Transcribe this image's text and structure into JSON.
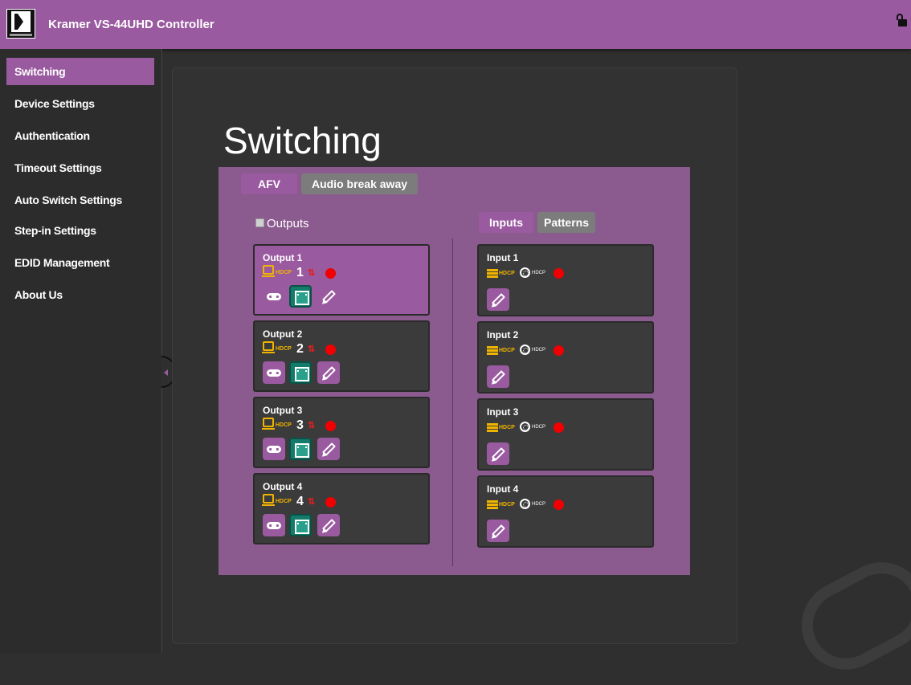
{
  "header": {
    "title": "Kramer VS-44UHD Controller"
  },
  "sidebar": {
    "items": [
      {
        "label": "Switching"
      },
      {
        "label": "Device Settings"
      },
      {
        "label": "Authentication"
      },
      {
        "label": "Timeout Settings"
      },
      {
        "label": "Auto Switch Settings"
      },
      {
        "label": "Step-in Settings"
      },
      {
        "label": "EDID Management"
      },
      {
        "label": "About Us"
      }
    ]
  },
  "main": {
    "title": "Switching",
    "tabs": {
      "afv": "AFV",
      "audio_break_away": "Audio break away"
    },
    "outputs_label": "Outputs",
    "input_tabs": {
      "inputs": "Inputs",
      "patterns": "Patterns"
    },
    "outputs": [
      {
        "title": "Output 1",
        "number": "1",
        "hdcp": "HDCP"
      },
      {
        "title": "Output 2",
        "number": "2",
        "hdcp": "HDCP"
      },
      {
        "title": "Output 3",
        "number": "3",
        "hdcp": "HDCP"
      },
      {
        "title": "Output 4",
        "number": "4",
        "hdcp": "HDCP"
      }
    ],
    "inputs": [
      {
        "title": "Input 1",
        "hdcp": "HDCP"
      },
      {
        "title": "Input 2",
        "hdcp": "HDCP"
      },
      {
        "title": "Input 3",
        "hdcp": "HDCP"
      },
      {
        "title": "Input 4",
        "hdcp": "HDCP"
      }
    ]
  },
  "colors": {
    "accent": "#9a5aa0",
    "panel": "#8b5a8e",
    "hdcp": "#f0b400",
    "status_red": "#f00000",
    "teal": "#147a6a"
  }
}
